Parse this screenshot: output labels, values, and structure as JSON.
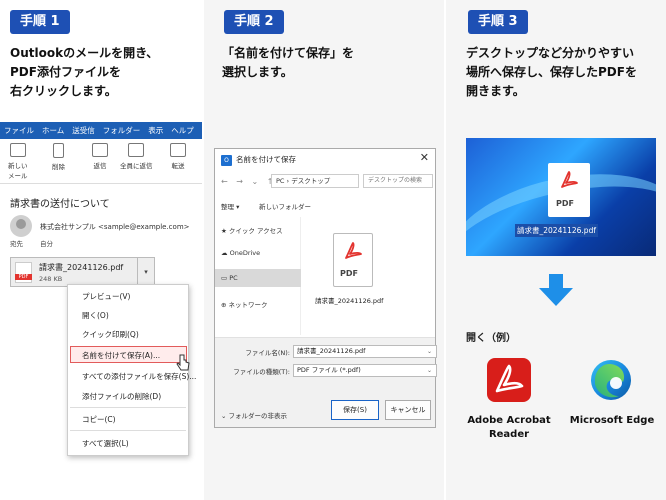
{
  "step1": {
    "badge": "手順 1",
    "desc_lines": [
      "Outlookのメールを開き、",
      "PDF添付ファイルを",
      "右クリックします。"
    ],
    "ribbon_tabs": [
      "ファイル",
      "ホーム",
      "送受信",
      "フォルダー",
      "表示",
      "ヘルプ"
    ],
    "tools": [
      "新しい",
      "メール",
      "削除",
      "返信",
      "全員に返信",
      "転送"
    ],
    "mail_subject": "請求書の送付について",
    "sender": "株式会社サンプル <sample@example.com>",
    "to_label": "宛先",
    "to_value": "自分",
    "attachment": {
      "name": "請求書_20241126.pdf",
      "size": "248 KB"
    },
    "context_menu": [
      "プレビュー(V)",
      "開く(O)",
      "クイック印刷(Q)",
      "名前を付けて保存(A)...",
      "すべての添付ファイルを保存(S)...",
      "添付ファイルの削除(D)",
      "コピー(C)",
      "すべて選択(L)"
    ]
  },
  "step2": {
    "badge": "手順 2",
    "desc_lines": [
      "「名前を付けて保存」を",
      "選択します。"
    ],
    "dialog_title": "名前を付けて保存",
    "path": "PC › デスクトップ",
    "search_placeholder": "デスクトップの検索",
    "organize": "整理 ▾",
    "new_folder": "新しいフォルダー",
    "sidebar": [
      "クイック アクセス",
      "OneDrive",
      "PC",
      "ネットワーク"
    ],
    "file_name": "請求書_20241126.pdf",
    "file_tag": "PDF",
    "filename_label": "ファイル名(N):",
    "filename_value": "請求書_20241126.pdf",
    "filetype_label": "ファイルの種類(T):",
    "filetype_value": "PDF ファイル (*.pdf)",
    "hide_folders": "フォルダーの非表示",
    "save": "保存(S)",
    "cancel": "キャンセル"
  },
  "step3": {
    "badge": "手順 3",
    "desc_lines": [
      "デスクトップなど分かりやすい",
      "場所へ保存し、保存したPDFを",
      "開きます。"
    ],
    "desktop_file": "請求書_20241126.pdf",
    "file_tag": "PDF",
    "open_label": "開く（例）",
    "app1_lines": [
      "Adobe Acrobat",
      "Reader"
    ],
    "app2": "Microsoft Edge"
  }
}
